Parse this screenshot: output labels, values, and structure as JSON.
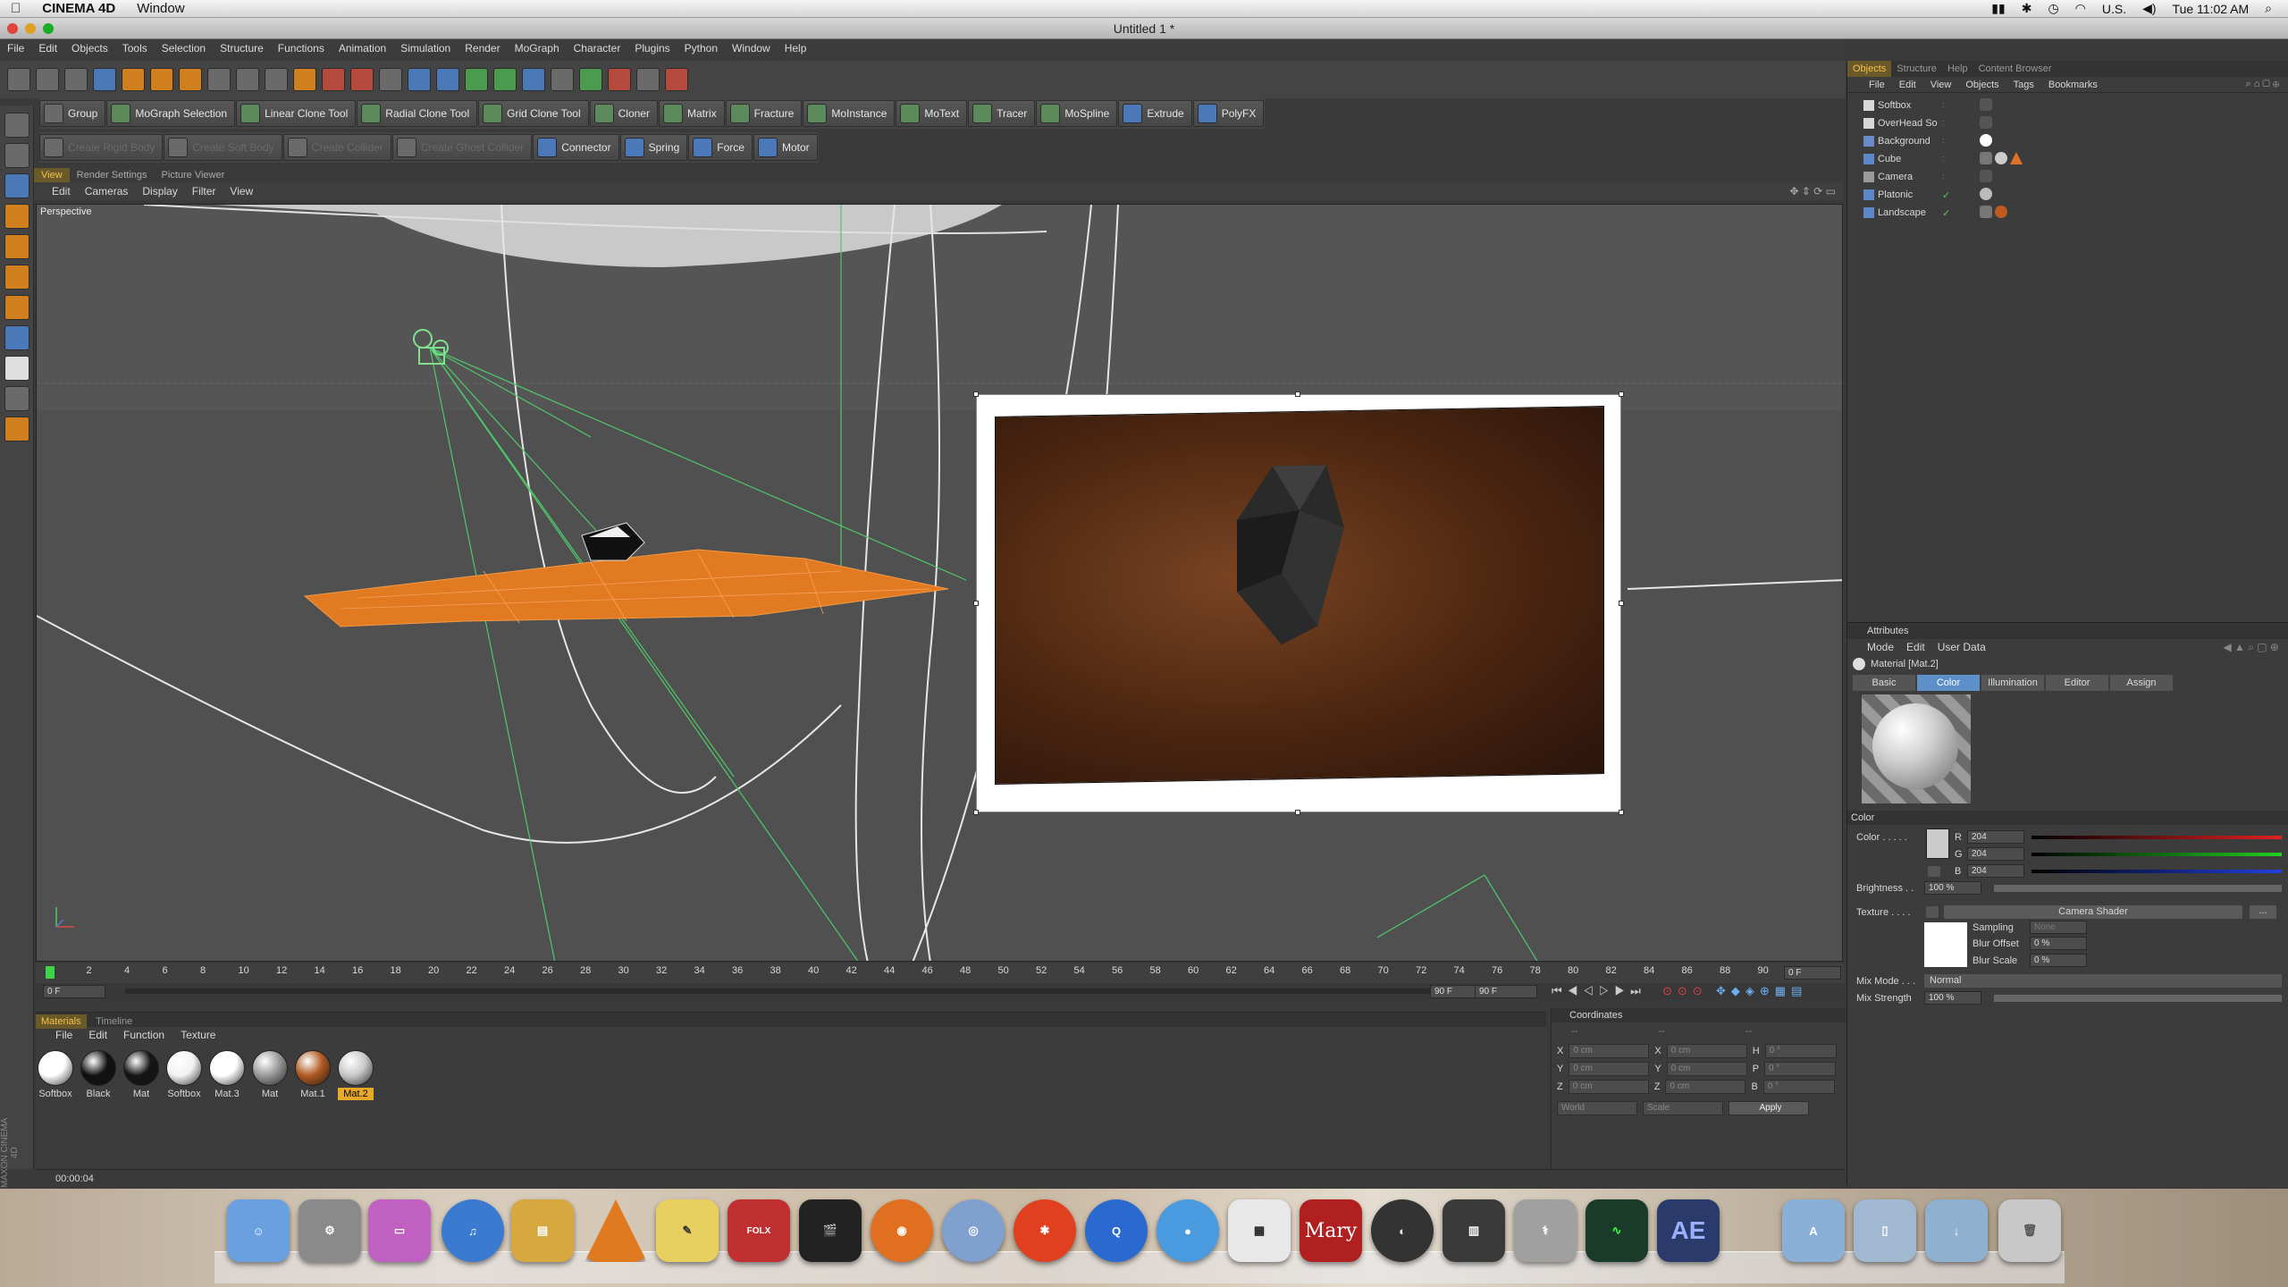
{
  "os_menubar": {
    "app_name": "CINEMA 4D",
    "menu": [
      "Window"
    ],
    "input_source": "U.S.",
    "clock": "Tue 11:02 AM"
  },
  "window": {
    "title": "Untitled 1 *"
  },
  "main_menu": [
    "File",
    "Edit",
    "Objects",
    "Tools",
    "Selection",
    "Structure",
    "Functions",
    "Animation",
    "Simulation",
    "Render",
    "MoGraph",
    "Character",
    "Plugins",
    "Python",
    "Window",
    "Help"
  ],
  "toolbar2": [
    "Group",
    "MoGraph Selection",
    "Linear Clone Tool",
    "Radial Clone Tool",
    "Grid Clone Tool",
    "Cloner",
    "Matrix",
    "Fracture",
    "MoInstance",
    "MoText",
    "Tracer",
    "MoSpline",
    "Extrude",
    "PolyFX"
  ],
  "toolbar3": {
    "disabled": [
      "Create Rigid Body",
      "Create Soft Body",
      "Create Collider",
      "Create Ghost Collider"
    ],
    "enabled": [
      "Connector",
      "Spring",
      "Force",
      "Motor"
    ]
  },
  "viewport": {
    "tabs": [
      "View",
      "Render Settings",
      "Picture Viewer"
    ],
    "menu": [
      "Edit",
      "Cameras",
      "Display",
      "Filter",
      "View"
    ],
    "label": "Perspective"
  },
  "timeline": {
    "ticks": [
      "0",
      "2",
      "4",
      "6",
      "8",
      "10",
      "12",
      "14",
      "16",
      "18",
      "20",
      "22",
      "24",
      "26",
      "28",
      "30",
      "32",
      "34",
      "36",
      "38",
      "40",
      "42",
      "44",
      "46",
      "48",
      "50",
      "52",
      "54",
      "56",
      "58",
      "60",
      "62",
      "64",
      "66",
      "68",
      "70",
      "72",
      "74",
      "76",
      "78",
      "80",
      "82",
      "84",
      "86",
      "88",
      "90"
    ],
    "current_frame": "0 F",
    "start_field": "0 F",
    "end_field_a": "90 F",
    "end_field_b": "90 F"
  },
  "materials": {
    "tabs": [
      "Materials",
      "Timeline"
    ],
    "menu": [
      "File",
      "Edit",
      "Function",
      "Texture"
    ],
    "items": [
      {
        "name": "Softbox",
        "color": "#ffffff"
      },
      {
        "name": "Black",
        "color": "#111111"
      },
      {
        "name": "Mat",
        "color": "#151515"
      },
      {
        "name": "Softbox",
        "color": "#f2f2f2"
      },
      {
        "name": "Mat.3",
        "color": "#ffffff"
      },
      {
        "name": "Mat",
        "color": "#9a9a9a"
      },
      {
        "name": "Mat.1",
        "color": "#b05a22"
      },
      {
        "name": "Mat.2",
        "color": "#c8c8c8"
      }
    ],
    "selected": "Mat.2"
  },
  "coordinates": {
    "title": "Coordinates",
    "rows": [
      {
        "a": "X",
        "av": "0 cm",
        "b": "X",
        "bv": "0 cm",
        "c": "H",
        "cv": "0 °"
      },
      {
        "a": "Y",
        "av": "0 cm",
        "b": "Y",
        "bv": "0 cm",
        "c": "P",
        "cv": "0 °"
      },
      {
        "a": "Z",
        "av": "0 cm",
        "b": "Z",
        "bv": "0 cm",
        "c": "B",
        "cv": "0 °"
      }
    ],
    "world": "World",
    "scale": "Scale",
    "apply": "Apply"
  },
  "status_time": "00:00:04",
  "maxon_label": "MAXON CINEMA 4D",
  "objects_manager": {
    "tabs": [
      "Objects",
      "Structure",
      "Help",
      "Content Browser"
    ],
    "menu": [
      "File",
      "Edit",
      "View",
      "Objects",
      "Tags",
      "Bookmarks"
    ],
    "items": [
      "Softbox",
      "OverHead So",
      "Background",
      "Cube",
      "Camera",
      "Platonic",
      "Landscape"
    ]
  },
  "attributes": {
    "title": "Attributes",
    "menu": [
      "Mode",
      "Edit",
      "User Data"
    ],
    "material_name": "Material [Mat.2]",
    "tabs": [
      "Basic",
      "Color",
      "Illumination",
      "Editor",
      "Assign"
    ],
    "active_tab": "Color",
    "section": "Color",
    "color_label": "Color . . . . .",
    "r_label": "R",
    "r_value": "204",
    "g_label": "G",
    "g_value": "204",
    "b_label": "B",
    "b_value": "204",
    "brightness_label": "Brightness . .",
    "brightness_value": "100 %",
    "texture_label": "Texture . . . .",
    "texture_shader": "Camera Shader",
    "sampling_label": "Sampling",
    "sampling_value": "None",
    "blur_offset_label": "Blur Offset",
    "blur_offset_value": "0 %",
    "blur_scale_label": "Blur Scale",
    "blur_scale_value": "0 %",
    "mix_mode_label": "Mix Mode . . .",
    "mix_mode_value": "Normal",
    "mix_strength_label": "Mix Strength",
    "mix_strength_value": "100 %"
  },
  "dock": {
    "mary_label": "Mary",
    "ae_label": "AE",
    "folx_label": "FOLX"
  }
}
